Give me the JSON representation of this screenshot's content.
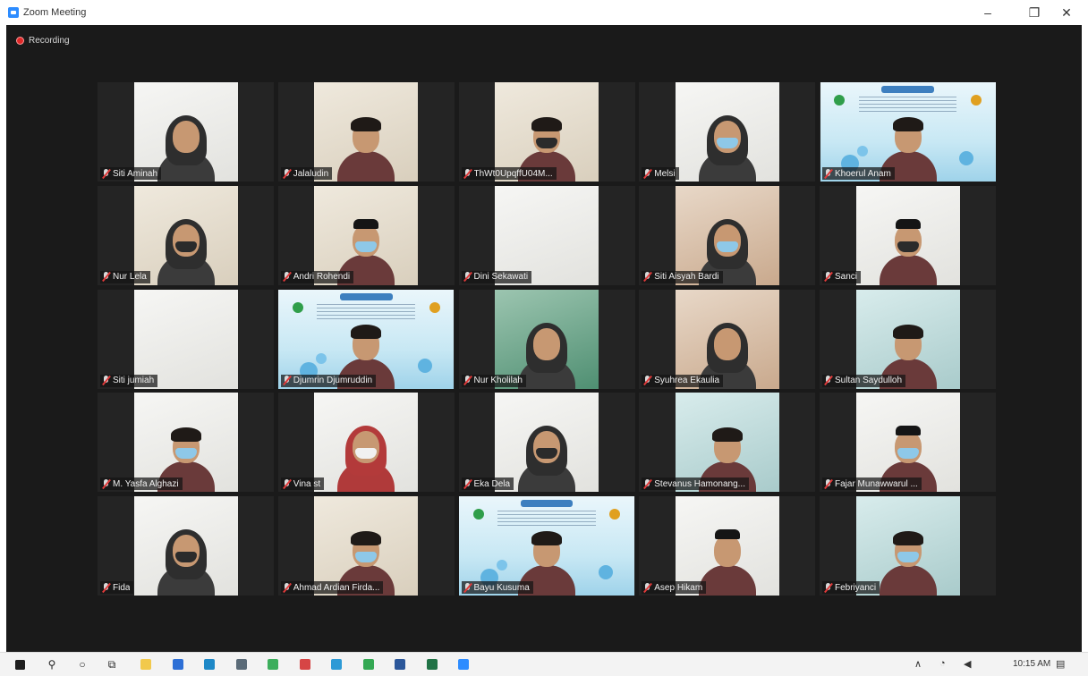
{
  "window": {
    "title": "Zoom Meeting",
    "controls": {
      "minimize": "–",
      "maximize": "❐",
      "close": "✕"
    }
  },
  "recording": {
    "label": "Recording",
    "color": "#e02828"
  },
  "participants": [
    {
      "name": "Siti Aminah",
      "style": "white",
      "figure": "hijab",
      "muted": true
    },
    {
      "name": "Jalaludin",
      "style": "room",
      "figure": "man",
      "muted": true
    },
    {
      "name": "ThWt0UpqffU04M...",
      "style": "room",
      "figure": "man-mask-dark",
      "muted": true
    },
    {
      "name": "Melsi",
      "style": "white",
      "figure": "hijab-mask",
      "muted": true
    },
    {
      "name": "Khoerul Anam",
      "style": "slide",
      "figure": "man",
      "muted": true
    },
    {
      "name": "Nur Lela",
      "style": "room",
      "figure": "hijab-mask-dark",
      "muted": true
    },
    {
      "name": "Andri Rohendi",
      "style": "room",
      "figure": "man-cap-mask",
      "muted": true
    },
    {
      "name": "Dini Sekawati",
      "style": "white",
      "figure": "none",
      "muted": true
    },
    {
      "name": "Siti Aisyah Bardi",
      "style": "warm",
      "figure": "hijab-mask",
      "muted": true
    },
    {
      "name": "Sanci",
      "style": "white",
      "figure": "man-cap-mask-dark",
      "muted": true
    },
    {
      "name": "Siti jumiah",
      "style": "white",
      "figure": "none",
      "muted": true
    },
    {
      "name": "Djumrin Djumruddin",
      "style": "slide",
      "figure": "man",
      "muted": true
    },
    {
      "name": "Nur Kholilah",
      "style": "green",
      "figure": "hijab",
      "muted": true
    },
    {
      "name": "Syuhrea Ekaulia",
      "style": "warm",
      "figure": "hijab",
      "muted": true
    },
    {
      "name": "Sultan Saydulloh",
      "style": "teal",
      "figure": "man",
      "muted": true
    },
    {
      "name": "M. Yasfa Alghazi",
      "style": "white",
      "figure": "man-mask",
      "muted": true
    },
    {
      "name": "Vina st",
      "style": "white",
      "figure": "hijab-red-mask",
      "muted": true
    },
    {
      "name": "Eka Dela",
      "style": "white",
      "figure": "hijab-mask-dark",
      "muted": true
    },
    {
      "name": "Stevanus Hamonang...",
      "style": "teal",
      "figure": "man",
      "muted": true
    },
    {
      "name": "Fajar Munawwarul ...",
      "style": "white",
      "figure": "man-cap-mask",
      "muted": true
    },
    {
      "name": "Fida",
      "style": "white",
      "figure": "hijab-mask-dark",
      "muted": true
    },
    {
      "name": "Ahmad Ardian Firda...",
      "style": "room",
      "figure": "man-mask",
      "muted": true
    },
    {
      "name": "Bayu Kusuma",
      "style": "slide",
      "figure": "man",
      "muted": true
    },
    {
      "name": "Asep Hikam",
      "style": "white",
      "figure": "man-cap",
      "muted": true
    },
    {
      "name": "Febriyanci",
      "style": "teal",
      "figure": "man-mask",
      "muted": true
    }
  ],
  "taskbar": {
    "start": "start-icon",
    "search": "search-icon",
    "cortana": "cortana-icon",
    "task_view": "task-view-icon",
    "pinned": [
      {
        "name": "file-explorer-icon",
        "color": "#f2c94c"
      },
      {
        "name": "store-icon",
        "color": "#2d6fd6"
      },
      {
        "name": "edge-icon",
        "color": "#1e88c7"
      },
      {
        "name": "calculator-icon",
        "color": "#5b6b78"
      },
      {
        "name": "android-icon",
        "color": "#3cae5c"
      },
      {
        "name": "red-app-icon",
        "color": "#d64545"
      },
      {
        "name": "cloud-app-icon",
        "color": "#2d9ad6"
      },
      {
        "name": "chrome-icon",
        "color": "#34a853"
      },
      {
        "name": "word-icon",
        "color": "#2b579a"
      },
      {
        "name": "excel-icon",
        "color": "#217346"
      },
      {
        "name": "zoom-icon",
        "color": "#2d8cff"
      }
    ],
    "clock": "10:15 AM"
  }
}
